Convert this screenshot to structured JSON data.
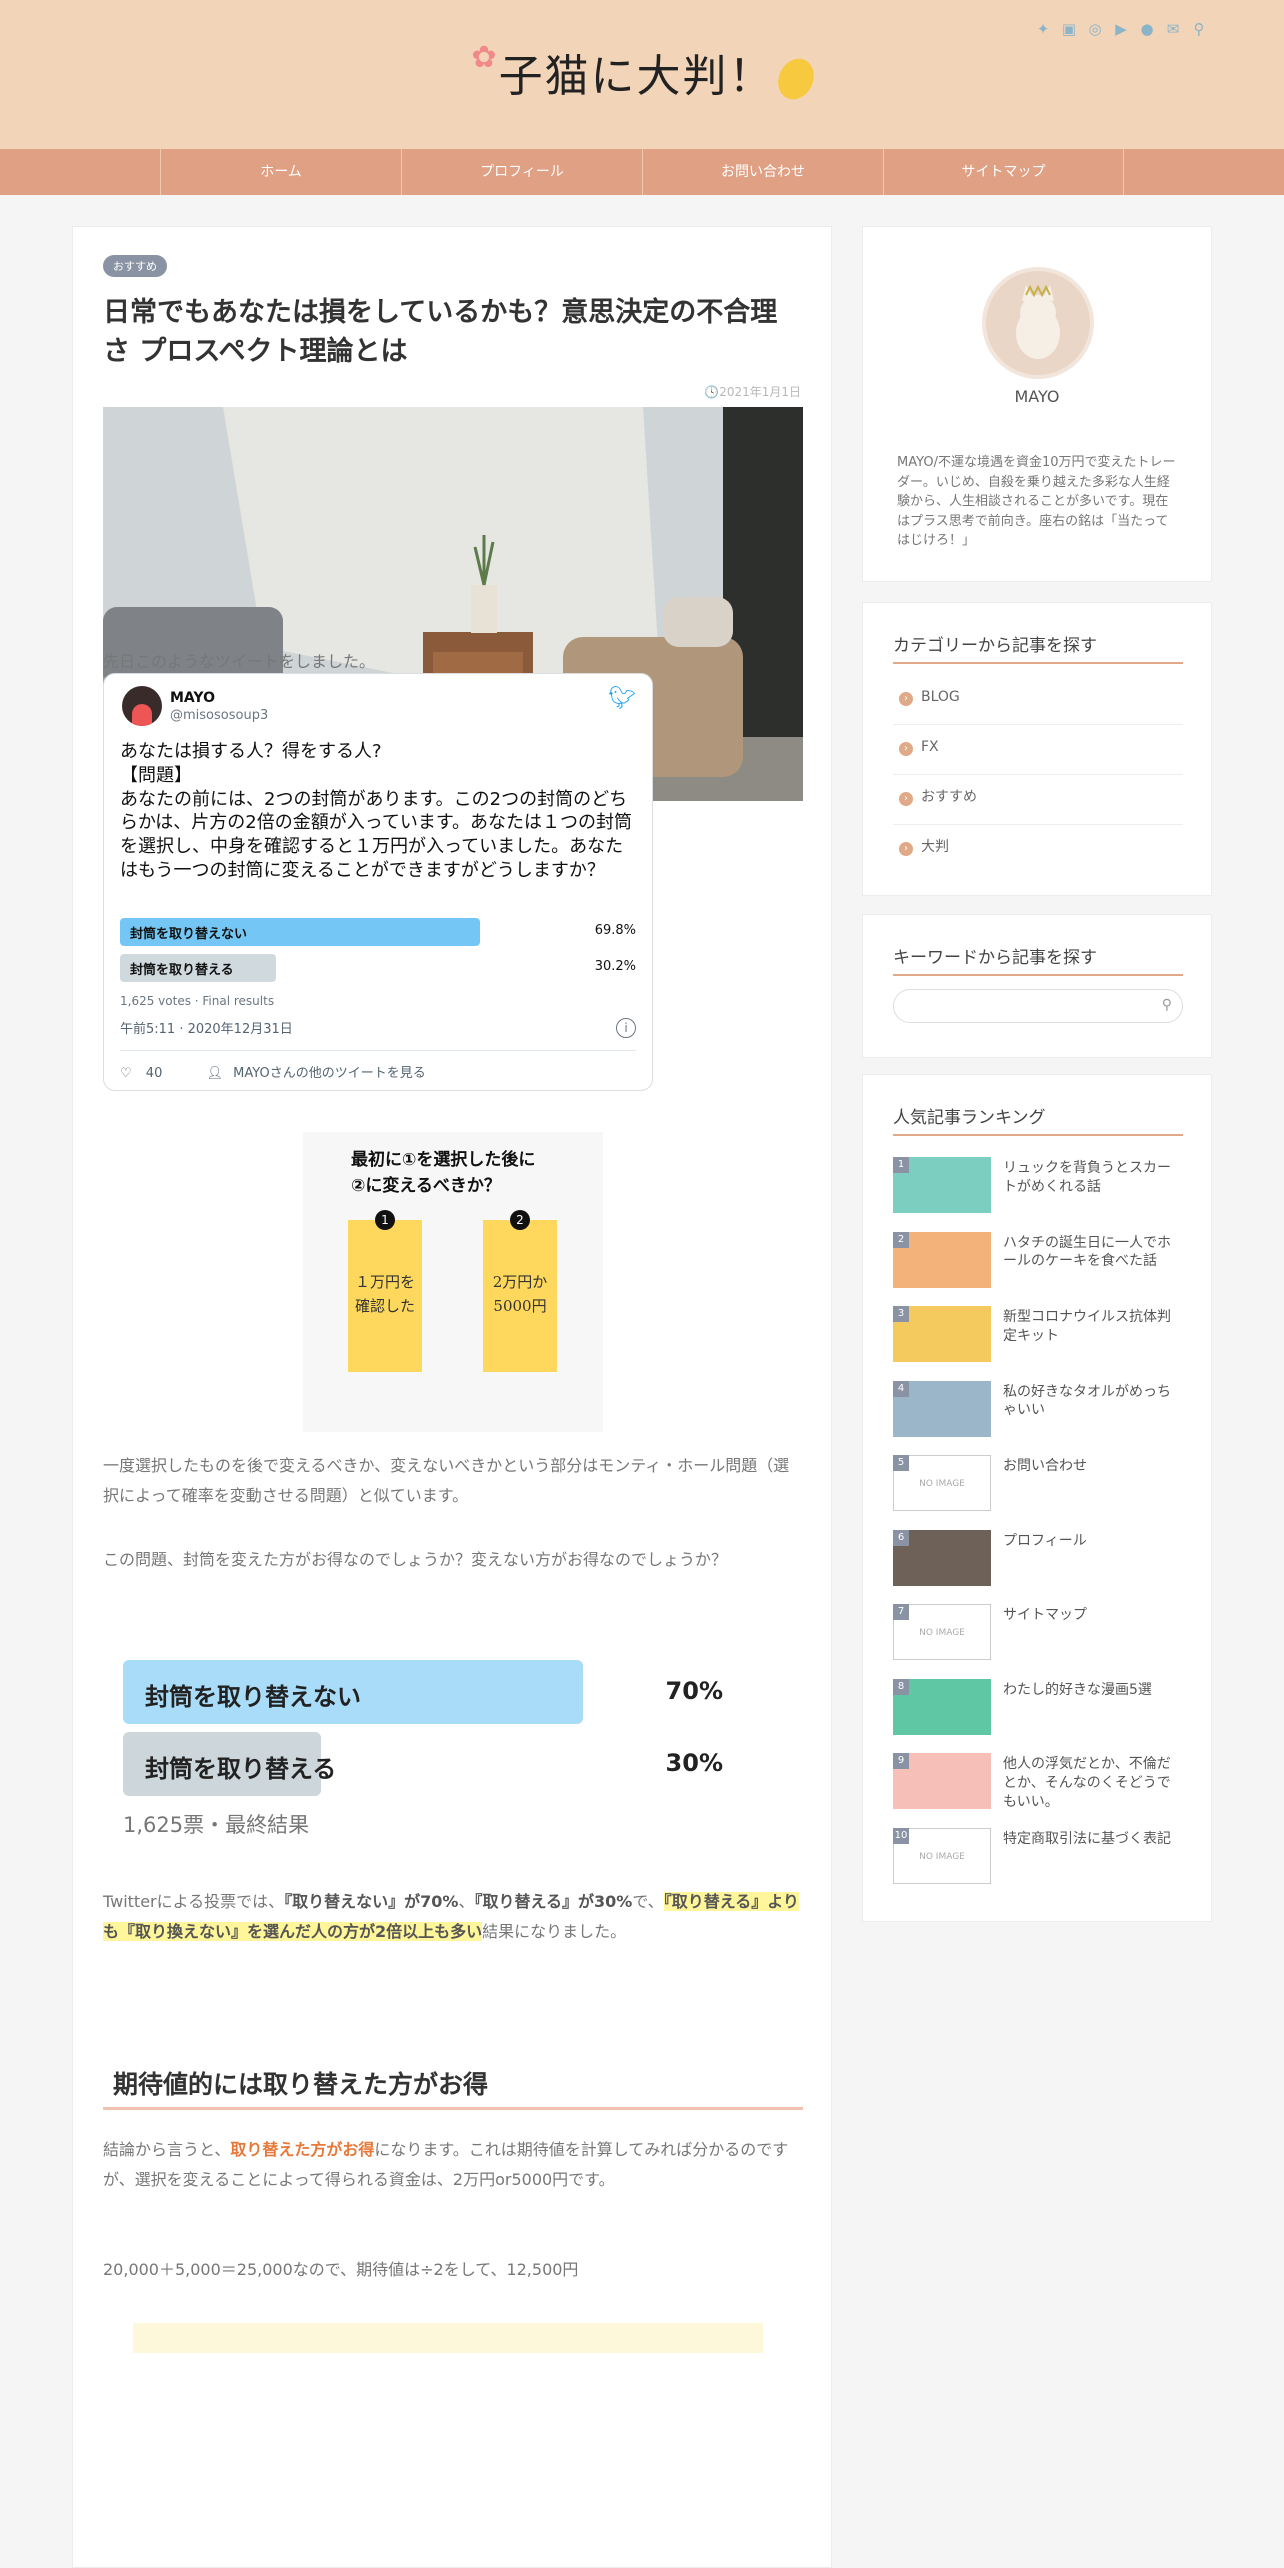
{
  "header": {
    "logo_text": "子猫に大判！",
    "sns_icons": [
      "twitter-icon",
      "facebook-icon",
      "instagram-icon",
      "youtube-icon",
      "line-icon",
      "mail-icon",
      "search-icon"
    ]
  },
  "nav": {
    "items": [
      "ホーム",
      "プロフィール",
      "お問い合わせ",
      "サイトマップ"
    ]
  },
  "article": {
    "badge": "おすすめ",
    "title": "日常でもあなたは損をしているかも？意思決定の不合理さ プロスペクト理論とは",
    "date": "2021年1月1日",
    "intro": "先日このようなツイートをしました。",
    "tweet": {
      "name": "MAYO",
      "handle": "@misososoup3",
      "text": "あなたは損する人？得をする人?\n【問題】\nあなたの前には、2つの封筒があります。この2つの封筒のどちらかは、片方の2倍の金額が入っています。あなたは１つの封筒を選択し、中身を確認すると１万円が入っていました。あなたはもう一つの封筒に変えることができますがどうしますか？",
      "poll": [
        {
          "label": "封筒を取り替えない",
          "percent": "69.8%",
          "value": 69.8
        },
        {
          "label": "封筒を取り替える",
          "percent": "30.2%",
          "value": 30.2
        }
      ],
      "votes": "1,625 votes · Final results",
      "time": "午前5:11 · 2020年12月31日",
      "likes": "40",
      "more": "MAYOさんの他のツイートを見る"
    },
    "envelope_figure": {
      "question": "最初に①を選択した後に\n②に変えるべきか？",
      "cards": [
        {
          "num": "❶",
          "text": "１万円を\n確認した"
        },
        {
          "num": "❷",
          "text": "2万円か\n5000円"
        }
      ]
    },
    "para1": "一度選択したものを後で変えるべきか、変えないべきかという部分はモンティ・ホール問題（選択によって確率を変動させる問題）と似ています。",
    "para2": "この問題、封筒を変えた方がお得なのでしょうか？変えない方がお得なのでしょうか？",
    "big_poll": [
      {
        "label": "封筒を取り替えない",
        "percent": "70%",
        "value": 70
      },
      {
        "label": "封筒を取り替える",
        "percent": "30%",
        "value": 30
      }
    ],
    "big_votes": "1,625票・最終結果",
    "para3_a": "Twitterによる投票では、",
    "para3_b": "『取り替えない』が70%",
    "para3_c": "、",
    "para3_d": "『取り替える』が30%",
    "para3_e": "で、",
    "para3_hl": "『取り替える』よりも『取り換えない』を選んだ人の方が2倍以上も多い",
    "para3_f": "結果になりました。",
    "h2": "期待値的には取り替えた方がお得",
    "para4_a": "結論から言うと、",
    "para4_b": "取り替えた方がお得",
    "para4_c": "になります。これは期待値を計算してみれば分かるのですが、選択を変えることによって得られる資金は、2万円or5000円です。",
    "para5": "20,000＋5,000＝25,000なので、期待値は÷2をして、12,500円"
  },
  "sidebar": {
    "profile": {
      "name": "MAYO",
      "bio": "MAYO/不運な境遇を資金10万円で変えたトレーダー。いじめ、自殺を乗り越えた多彩な人生経験から、人生相談されることが多いです。現在はプラス思考で前向き。座右の銘は「当たってはじけろ！」"
    },
    "categories": {
      "title": "カテゴリーから記事を探す",
      "items": [
        "BLOG",
        "FX",
        "おすすめ",
        "大判"
      ]
    },
    "search": {
      "title": "キーワードから記事を探す",
      "placeholder": ""
    },
    "ranking": {
      "title": "人気記事ランキング",
      "items": [
        {
          "no": "1",
          "title": "リュックを背負うとスカートがめくれる話",
          "thumb": "#7ccfc0"
        },
        {
          "no": "2",
          "title": "ハタチの誕生日に一人でホールのケーキを食べた話",
          "thumb": "#f2b27a"
        },
        {
          "no": "3",
          "title": "新型コロナウイルス抗体判定キット",
          "thumb": "#f4c95d"
        },
        {
          "no": "4",
          "title": "私の好きなタオルがめっちゃいい",
          "thumb": "#9bb6c9"
        },
        {
          "no": "5",
          "title": "お問い合わせ",
          "thumb": "noimage"
        },
        {
          "no": "6",
          "title": "プロフィール",
          "thumb": "#6d6158"
        },
        {
          "no": "7",
          "title": "サイトマップ",
          "thumb": "noimage"
        },
        {
          "no": "8",
          "title": "わたし的好きな漫画5選",
          "thumb": "#5fc7a4"
        },
        {
          "no": "9",
          "title": "他人の浮気だとか、不倫だとか、そんなのくそどうでもいい。",
          "thumb": "#f6c0b8"
        },
        {
          "no": "10",
          "title": "特定商取引法に基づく表記",
          "thumb": "noimage"
        }
      ],
      "noimage_label": "NO IMAGE"
    }
  }
}
